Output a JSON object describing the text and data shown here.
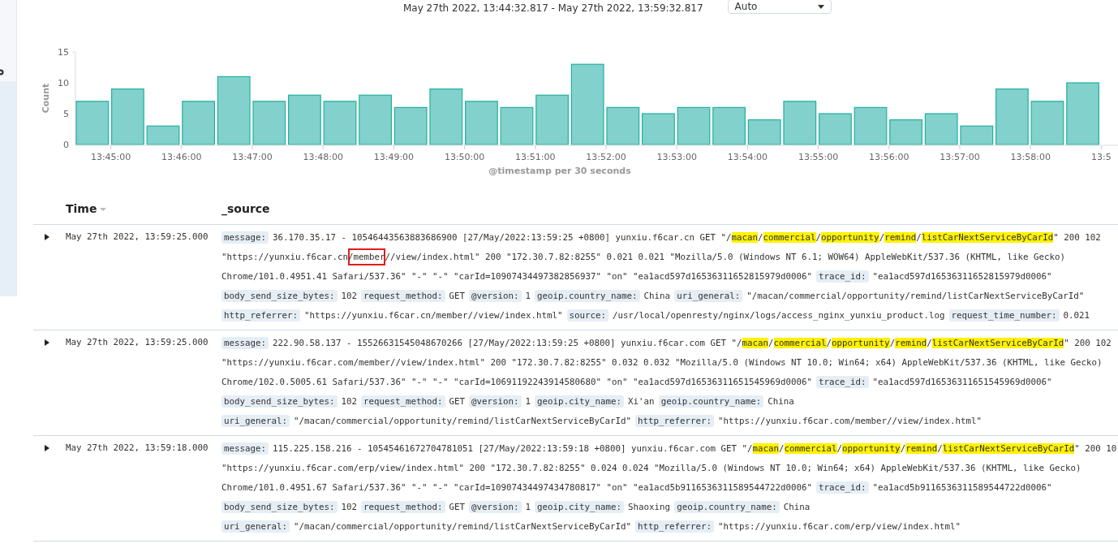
{
  "header": {
    "time_range": "May 27th 2022, 13:44:32.817 - May 27th 2022, 13:59:32.817",
    "interval": "Auto"
  },
  "histogram": {
    "chart_data": {
      "type": "bar",
      "ylabel": "Count",
      "xlabel": "@timestamp per 30 seconds",
      "categories": [
        null,
        "13:45:00",
        null,
        "13:46:00",
        null,
        "13:47:00",
        null,
        "13:48:00",
        null,
        "13:49:00",
        null,
        "13:50:00",
        null,
        "13:51:00",
        null,
        "13:52:00",
        null,
        "13:53:00",
        null,
        "13:54:00",
        null,
        "13:55:00",
        null,
        "13:56:00",
        null,
        "13:57:00",
        null,
        "13:58:00",
        null,
        "13:5"
      ],
      "series": [
        {
          "color": "#82d1cc",
          "values": [
            7,
            9,
            3,
            7,
            11,
            7,
            8,
            7,
            8,
            6,
            9,
            7,
            6,
            8,
            13,
            6,
            5,
            6,
            6,
            4,
            7,
            5,
            6,
            4,
            5,
            3,
            9,
            7,
            10,
            null
          ]
        }
      ],
      "ylim": [
        0,
        15
      ],
      "yticks": [
        0,
        5,
        10,
        15
      ]
    }
  },
  "table": {
    "columns": [
      {
        "label": "Time",
        "sorted": true
      },
      {
        "label": "_source",
        "sorted": false
      }
    ],
    "rows": [
      {
        "expanded": false,
        "time": "May 27th 2022, 13:59:25.000",
        "lines": [
          [
            {
              "kind": "key",
              "text": "message:"
            },
            {
              "kind": "text",
              "text": "36.170.35.17 - 10546443563883686900 [27/May/2022:13:59:25 +0800] yunxiu.f6car.cn GET \"/"
            },
            {
              "kind": "highlight",
              "text": "macan"
            },
            {
              "kind": "text",
              "text": "/"
            },
            {
              "kind": "highlight",
              "text": "commercial"
            },
            {
              "kind": "text",
              "text": "/"
            },
            {
              "kind": "highlight",
              "text": "opportunity"
            },
            {
              "kind": "text",
              "text": "/"
            },
            {
              "kind": "highlight",
              "text": "remind"
            },
            {
              "kind": "text",
              "text": "/"
            },
            {
              "kind": "highlight",
              "text": "listCarNextServiceByCarId"
            },
            {
              "kind": "text",
              "text": "\" 200 102"
            }
          ],
          [
            {
              "kind": "text",
              "text": "\"https://yunxiu.f6car.cn"
            },
            {
              "kind": "boxed",
              "text": "/member"
            },
            {
              "kind": "text",
              "text": "//view/index.html\" 200 \"172.30.7.82:8255\" 0.021 0.021 \"Mozilla/5.0 (Windows NT 6.1; WOW64) AppleWebKit/537.36 (KHTML, like Gecko)"
            }
          ],
          [
            {
              "kind": "text",
              "text": "Chrome/101.0.4951.41 Safari/537.36\" \"-\" \"-\" \"carId=10907434497382856937\" \"on\" \"ea1acd597d16536311652815979d0006\""
            },
            {
              "kind": "key",
              "text": "trace_id:"
            },
            {
              "kind": "text",
              "text": "\"ea1acd597d16536311652815979d0006\""
            }
          ],
          [
            {
              "kind": "key",
              "text": "body_send_size_bytes:"
            },
            {
              "kind": "text",
              "text": "102"
            },
            {
              "kind": "key",
              "text": "request_method:"
            },
            {
              "kind": "text",
              "text": "GET"
            },
            {
              "kind": "key",
              "text": "@version:"
            },
            {
              "kind": "text",
              "text": "1"
            },
            {
              "kind": "key",
              "text": "geoip.country_name:"
            },
            {
              "kind": "text",
              "text": "China"
            },
            {
              "kind": "key",
              "text": "uri_general:"
            },
            {
              "kind": "text",
              "text": "\"/macan/commercial/opportunity/remind/listCarNextServiceByCarId\""
            }
          ],
          [
            {
              "kind": "key",
              "text": "http_referrer:"
            },
            {
              "kind": "text",
              "text": "\"https://yunxiu.f6car.cn/member//view/index.html\""
            },
            {
              "kind": "key",
              "text": "source:"
            },
            {
              "kind": "text",
              "text": "/usr/local/openresty/nginx/logs/access_nginx_yunxiu_product.log"
            },
            {
              "kind": "key",
              "text": "request_time_number:"
            },
            {
              "kind": "text",
              "text": "0.021"
            }
          ]
        ]
      },
      {
        "expanded": false,
        "time": "May 27th 2022, 13:59:25.000",
        "lines": [
          [
            {
              "kind": "key",
              "text": "message:"
            },
            {
              "kind": "text",
              "text": "222.90.58.137 - 15526631545048670266 [27/May/2022:13:59:25 +0800] yunxiu.f6car.com GET \"/"
            },
            {
              "kind": "highlight",
              "text": "macan"
            },
            {
              "kind": "text",
              "text": "/"
            },
            {
              "kind": "highlight",
              "text": "commercial"
            },
            {
              "kind": "text",
              "text": "/"
            },
            {
              "kind": "highlight",
              "text": "opportunity"
            },
            {
              "kind": "text",
              "text": "/"
            },
            {
              "kind": "highlight",
              "text": "remind"
            },
            {
              "kind": "text",
              "text": "/"
            },
            {
              "kind": "highlight",
              "text": "listCarNextServiceByCarId"
            },
            {
              "kind": "text",
              "text": "\" 200 102"
            }
          ],
          [
            {
              "kind": "text",
              "text": "\"https://yunxiu.f6car.com/member//view/index.html\" 200 \"172.30.7.82:8255\" 0.032 0.032 \"Mozilla/5.0 (Windows NT 10.0; Win64; x64) AppleWebKit/537.36 (KHTML, like Gecko)"
            }
          ],
          [
            {
              "kind": "text",
              "text": "Chrome/102.0.5005.61 Safari/537.36\" \"-\" \"-\" \"carId=10691192243914580680\" \"on\" \"ea1acd597d16536311651545969d0006\""
            },
            {
              "kind": "key",
              "text": "trace_id:"
            },
            {
              "kind": "text",
              "text": "\"ea1acd597d16536311651545969d0006\""
            }
          ],
          [
            {
              "kind": "key",
              "text": "body_send_size_bytes:"
            },
            {
              "kind": "text",
              "text": "102"
            },
            {
              "kind": "key",
              "text": "request_method:"
            },
            {
              "kind": "text",
              "text": "GET"
            },
            {
              "kind": "key",
              "text": "@version:"
            },
            {
              "kind": "text",
              "text": "1"
            },
            {
              "kind": "key",
              "text": "geoip.city_name:"
            },
            {
              "kind": "text",
              "text": "Xi'an"
            },
            {
              "kind": "key",
              "text": "geoip.country_name:"
            },
            {
              "kind": "text",
              "text": "China"
            }
          ],
          [
            {
              "kind": "key",
              "text": "uri_general:"
            },
            {
              "kind": "text",
              "text": "\"/macan/commercial/opportunity/remind/listCarNextServiceByCarId\""
            },
            {
              "kind": "key",
              "text": "http_referrer:"
            },
            {
              "kind": "text",
              "text": "\"https://yunxiu.f6car.com/member//view/index.html\""
            }
          ]
        ]
      },
      {
        "expanded": false,
        "time": "May 27th 2022, 13:59:18.000",
        "lines": [
          [
            {
              "kind": "key",
              "text": "message:"
            },
            {
              "kind": "text",
              "text": "115.225.158.216 - 10545461672704781051 [27/May/2022:13:59:18 +0800] yunxiu.f6car.com GET \"/"
            },
            {
              "kind": "highlight",
              "text": "macan"
            },
            {
              "kind": "text",
              "text": "/"
            },
            {
              "kind": "highlight",
              "text": "commercial"
            },
            {
              "kind": "text",
              "text": "/"
            },
            {
              "kind": "highlight",
              "text": "opportunity"
            },
            {
              "kind": "text",
              "text": "/"
            },
            {
              "kind": "highlight",
              "text": "remind"
            },
            {
              "kind": "text",
              "text": "/"
            },
            {
              "kind": "highlight",
              "text": "listCarNextServiceByCarId"
            },
            {
              "kind": "text",
              "text": "\" 200 10"
            }
          ],
          [
            {
              "kind": "text",
              "text": "\"https://yunxiu.f6car.com/erp/view/index.html\" 200 \"172.30.7.82:8255\" 0.024 0.024 \"Mozilla/5.0 (Windows NT 10.0; Win64; x64) AppleWebKit/537.36 (KHTML, like Gecko)"
            }
          ],
          [
            {
              "kind": "text",
              "text": "Chrome/101.0.4951.67 Safari/537.36\" \"-\" \"-\" \"carId=10907434497434780817\" \"on\" \"ea1acd5b9116536311589544722d0006\""
            },
            {
              "kind": "key",
              "text": "trace_id:"
            },
            {
              "kind": "text",
              "text": "\"ea1acd5b9116536311589544722d0006\""
            }
          ],
          [
            {
              "kind": "key",
              "text": "body_send_size_bytes:"
            },
            {
              "kind": "text",
              "text": "102"
            },
            {
              "kind": "key",
              "text": "request_method:"
            },
            {
              "kind": "text",
              "text": "GET"
            },
            {
              "kind": "key",
              "text": "@version:"
            },
            {
              "kind": "text",
              "text": "1"
            },
            {
              "kind": "key",
              "text": "geoip.city_name:"
            },
            {
              "kind": "text",
              "text": "Shaoxing"
            },
            {
              "kind": "key",
              "text": "geoip.country_name:"
            },
            {
              "kind": "text",
              "text": "China"
            }
          ],
          [
            {
              "kind": "key",
              "text": "uri_general:"
            },
            {
              "kind": "text",
              "text": "\"/macan/commercial/opportunity/remind/listCarNextServiceByCarId\""
            },
            {
              "kind": "key",
              "text": "http_referrer:"
            },
            {
              "kind": "text",
              "text": "\"https://yunxiu.f6car.com/erp/view/index.html\""
            }
          ]
        ]
      }
    ]
  }
}
